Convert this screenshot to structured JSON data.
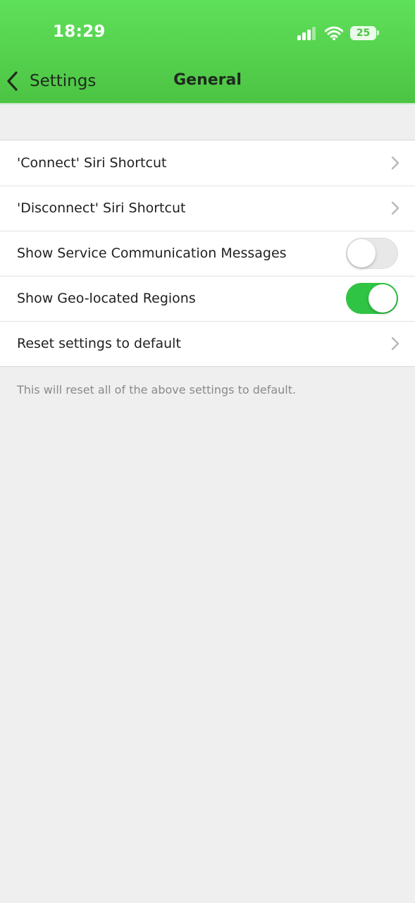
{
  "status_bar": {
    "time": "18:29",
    "battery": "25"
  },
  "nav": {
    "back_label": "Settings",
    "title": "General"
  },
  "rows": [
    {
      "label": "'Connect' Siri Shortcut",
      "control": "chevron"
    },
    {
      "label": "'Disconnect' Siri Shortcut",
      "control": "chevron"
    },
    {
      "label": "Show Service Communication Messages",
      "control": "toggle",
      "enabled": false
    },
    {
      "label": "Show Geo-located Regions",
      "control": "toggle",
      "enabled": true
    },
    {
      "label": "Reset settings to default",
      "control": "chevron"
    }
  ],
  "footnote": "This will reset all of the above settings to default.",
  "colors": {
    "header_green": "#4cc443",
    "toggle_on": "#2fc443",
    "background": "#efefef"
  },
  "icons": {
    "back": "chevron-left-icon",
    "row_disclosure": "chevron-right-icon",
    "signal": "cellular-signal-icon",
    "wifi": "wifi-icon",
    "battery": "battery-icon"
  }
}
